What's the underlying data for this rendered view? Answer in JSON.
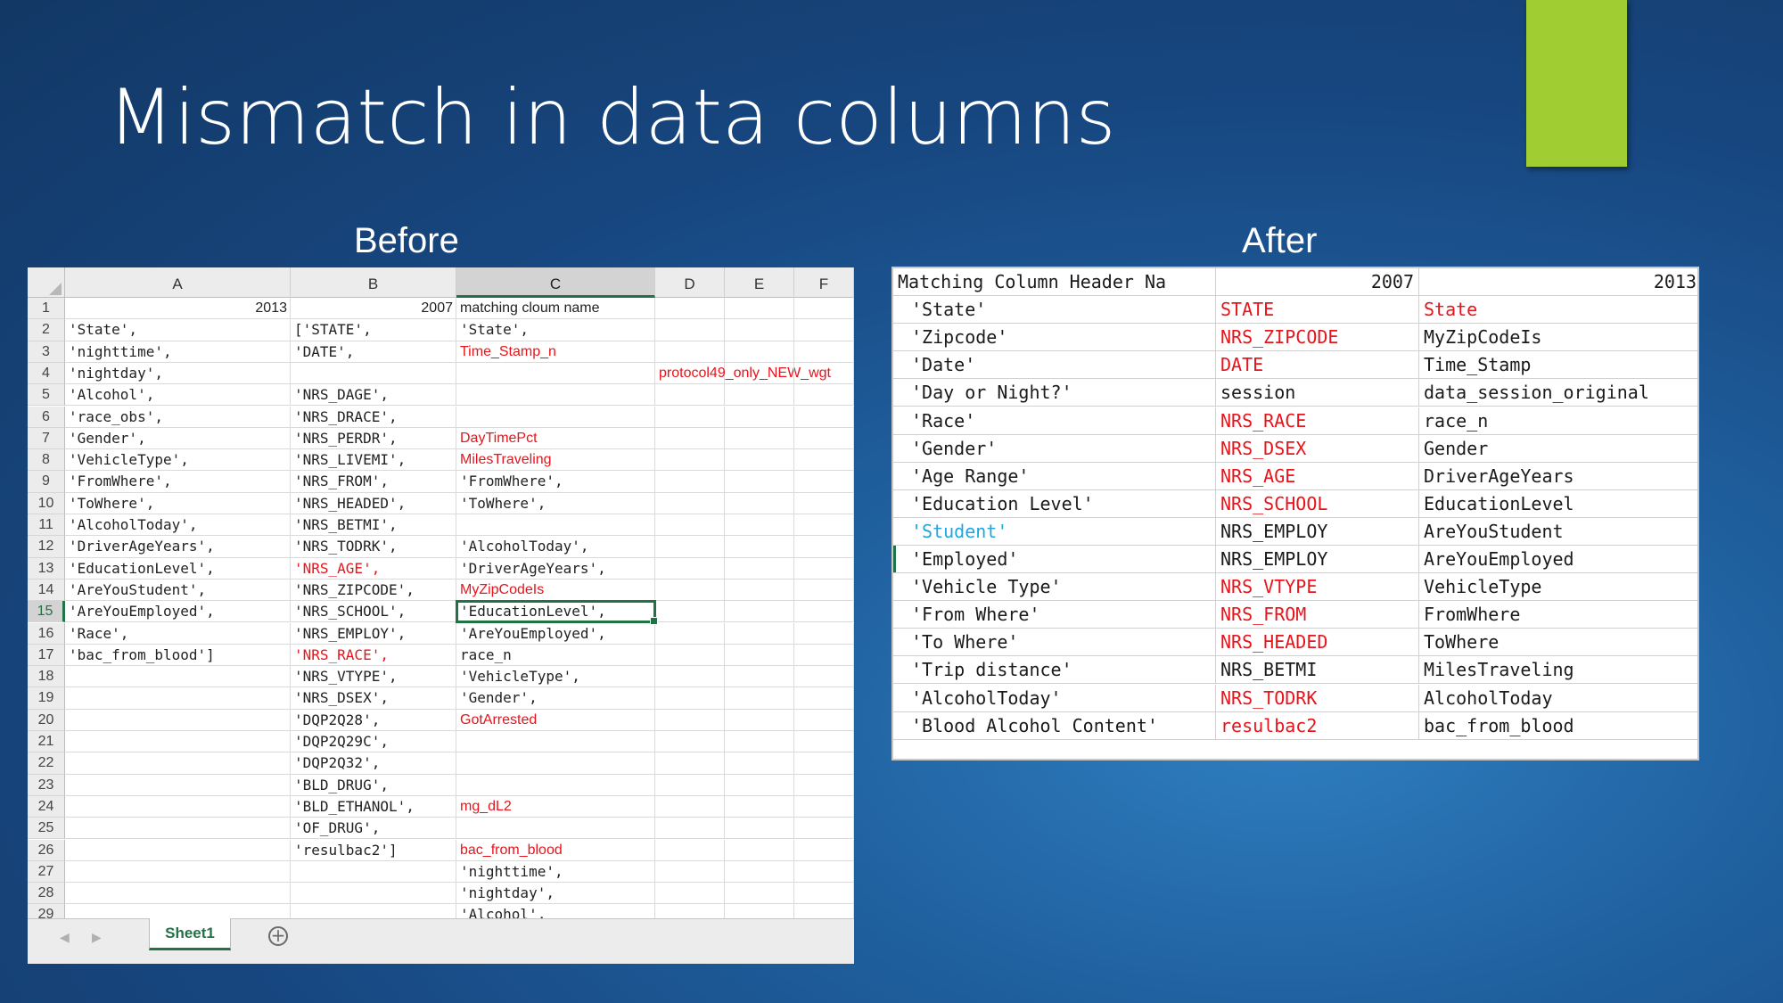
{
  "slide": {
    "title": "Mismatch in data columns",
    "before_caption": "Before",
    "after_caption": "After",
    "accent_color": "#9fcd32"
  },
  "excel": {
    "columns": [
      "A",
      "B",
      "C",
      "D",
      "E",
      "F"
    ],
    "selected_column": "C",
    "selected_row": "15",
    "sheet_tab": "Sheet1",
    "add_sheet_icon": "plus-circle-icon",
    "rows": [
      {
        "n": "1",
        "a": "2013",
        "b": "2007",
        "c": "matching cloum name",
        "d": ""
      },
      {
        "n": "2",
        "a": "'State',",
        "b": "['STATE',",
        "c": "'State',",
        "d": ""
      },
      {
        "n": "3",
        "a": " 'nighttime',",
        "b": " 'DATE',",
        "c": "Time_Stamp_n",
        "d": ""
      },
      {
        "n": "4",
        "a": " 'nightday',",
        "b": "",
        "c": "",
        "d": "protocol49_only_NEW_wgt"
      },
      {
        "n": "5",
        "a": " 'Alcohol',",
        "b": " 'NRS_DAGE',",
        "c": "",
        "d": ""
      },
      {
        "n": "6",
        "a": " 'race_obs',",
        "b": " 'NRS_DRACE',",
        "c": "",
        "d": ""
      },
      {
        "n": "7",
        "a": " 'Gender',",
        "b": " 'NRS_PERDR',",
        "c": "DayTimePct",
        "d": ""
      },
      {
        "n": "8",
        "a": " 'VehicleType',",
        "b": " 'NRS_LIVEMI',",
        "c": "MilesTraveling",
        "d": ""
      },
      {
        "n": "9",
        "a": " 'FromWhere',",
        "b": " 'NRS_FROM',",
        "c": "  'FromWhere',",
        "d": ""
      },
      {
        "n": "10",
        "a": " 'ToWhere',",
        "b": " 'NRS_HEADED',",
        "c": "  'ToWhere',",
        "d": ""
      },
      {
        "n": "11",
        "a": " 'AlcoholToday',",
        "b": " 'NRS_BETMI',",
        "c": "",
        "d": ""
      },
      {
        "n": "12",
        "a": " 'DriverAgeYears',",
        "b": " 'NRS_TODRK',",
        "c": "  'AlcoholToday',",
        "d": ""
      },
      {
        "n": "13",
        "a": " 'EducationLevel',",
        "b": " 'NRS_AGE',",
        "c": "  'DriverAgeYears',",
        "d": ""
      },
      {
        "n": "14",
        "a": " 'AreYouStudent',",
        "b": " 'NRS_ZIPCODE',",
        "c": "MyZipCodeIs",
        "d": ""
      },
      {
        "n": "15",
        "a": " 'AreYouEmployed',",
        "b": " 'NRS_SCHOOL',",
        "c": "  'EducationLevel',",
        "d": ""
      },
      {
        "n": "16",
        "a": " 'Race',",
        "b": " 'NRS_EMPLOY',",
        "c": "  'AreYouEmployed',",
        "d": ""
      },
      {
        "n": "17",
        "a": " 'bac_from_blood']",
        "b": " 'NRS_RACE',",
        "c": "race_n",
        "d": ""
      },
      {
        "n": "18",
        "a": "",
        "b": " 'NRS_VTYPE',",
        "c": "  'VehicleType',",
        "d": ""
      },
      {
        "n": "19",
        "a": "",
        "b": " 'NRS_DSEX',",
        "c": "  'Gender',",
        "d": ""
      },
      {
        "n": "20",
        "a": "",
        "b": " 'DQP2Q28',",
        "c": "GotArrested",
        "d": ""
      },
      {
        "n": "21",
        "a": "",
        "b": " 'DQP2Q29C',",
        "c": "",
        "d": ""
      },
      {
        "n": "22",
        "a": "",
        "b": " 'DQP2Q32',",
        "c": "",
        "d": ""
      },
      {
        "n": "23",
        "a": "",
        "b": " 'BLD_DRUG',",
        "c": "",
        "d": ""
      },
      {
        "n": "24",
        "a": "",
        "b": " 'BLD_ETHANOL',",
        "c": "mg_dL2",
        "d": ""
      },
      {
        "n": "25",
        "a": "",
        "b": " 'OF_DRUG',",
        "c": "",
        "d": ""
      },
      {
        "n": "26",
        "a": "",
        "b": " 'resulbac2']",
        "c": "bac_from_blood",
        "d": ""
      },
      {
        "n": "27",
        "a": "",
        "b": "",
        "c": "  'nighttime',",
        "d": ""
      },
      {
        "n": "28",
        "a": "",
        "b": "",
        "c": "  'nightday',",
        "d": ""
      },
      {
        "n": "29",
        "a": "",
        "b": "",
        "c": "  'Alcohol',",
        "d": ""
      }
    ]
  },
  "after_table": {
    "header": [
      "Matching Column Header Na",
      "2007",
      "2013"
    ],
    "rows": [
      {
        "name": "'State'",
        "v2007": "STATE",
        "v2013": "State"
      },
      {
        "name": "'Zipcode'",
        "v2007": "NRS_ZIPCODE",
        "v2013": "MyZipCodeIs"
      },
      {
        "name": "'Date'",
        "v2007": "DATE",
        "v2013": "Time_Stamp"
      },
      {
        "name": "'Day or Night?'",
        "v2007": "session",
        "v2013": "data_session_original"
      },
      {
        "name": "'Race'",
        "v2007": "NRS_RACE",
        "v2013": "race_n"
      },
      {
        "name": "'Gender'",
        "v2007": "NRS_DSEX",
        "v2013": "Gender"
      },
      {
        "name": "'Age Range'",
        "v2007": "NRS_AGE",
        "v2013": "DriverAgeYears"
      },
      {
        "name": "'Education Level'",
        "v2007": "NRS_SCHOOL",
        "v2013": "EducationLevel"
      },
      {
        "name": "'Student'",
        "v2007": "NRS_EMPLOY",
        "v2013": "AreYouStudent"
      },
      {
        "name": "'Employed'",
        "v2007": "NRS_EMPLOY",
        "v2013": "AreYouEmployed"
      },
      {
        "name": "'Vehicle Type'",
        "v2007": "NRS_VTYPE",
        "v2013": "VehicleType"
      },
      {
        "name": "'From Where'",
        "v2007": "NRS_FROM",
        "v2013": "FromWhere"
      },
      {
        "name": "'To Where'",
        "v2007": "NRS_HEADED",
        "v2013": "ToWhere"
      },
      {
        "name": "'Trip distance'",
        "v2007": "NRS_BETMI",
        "v2013": "MilesTraveling"
      },
      {
        "name": "'AlcoholToday'",
        "v2007": "NRS_TODRK",
        "v2013": "AlcoholToday"
      },
      {
        "name": "'Blood Alcohol Content'",
        "v2007": "resulbac2",
        "v2013": "bac_from_blood"
      }
    ]
  },
  "colors": {
    "red_text": "#e8141b",
    "cyan_text": "#1fa6e0",
    "excel_green": "#217346"
  }
}
